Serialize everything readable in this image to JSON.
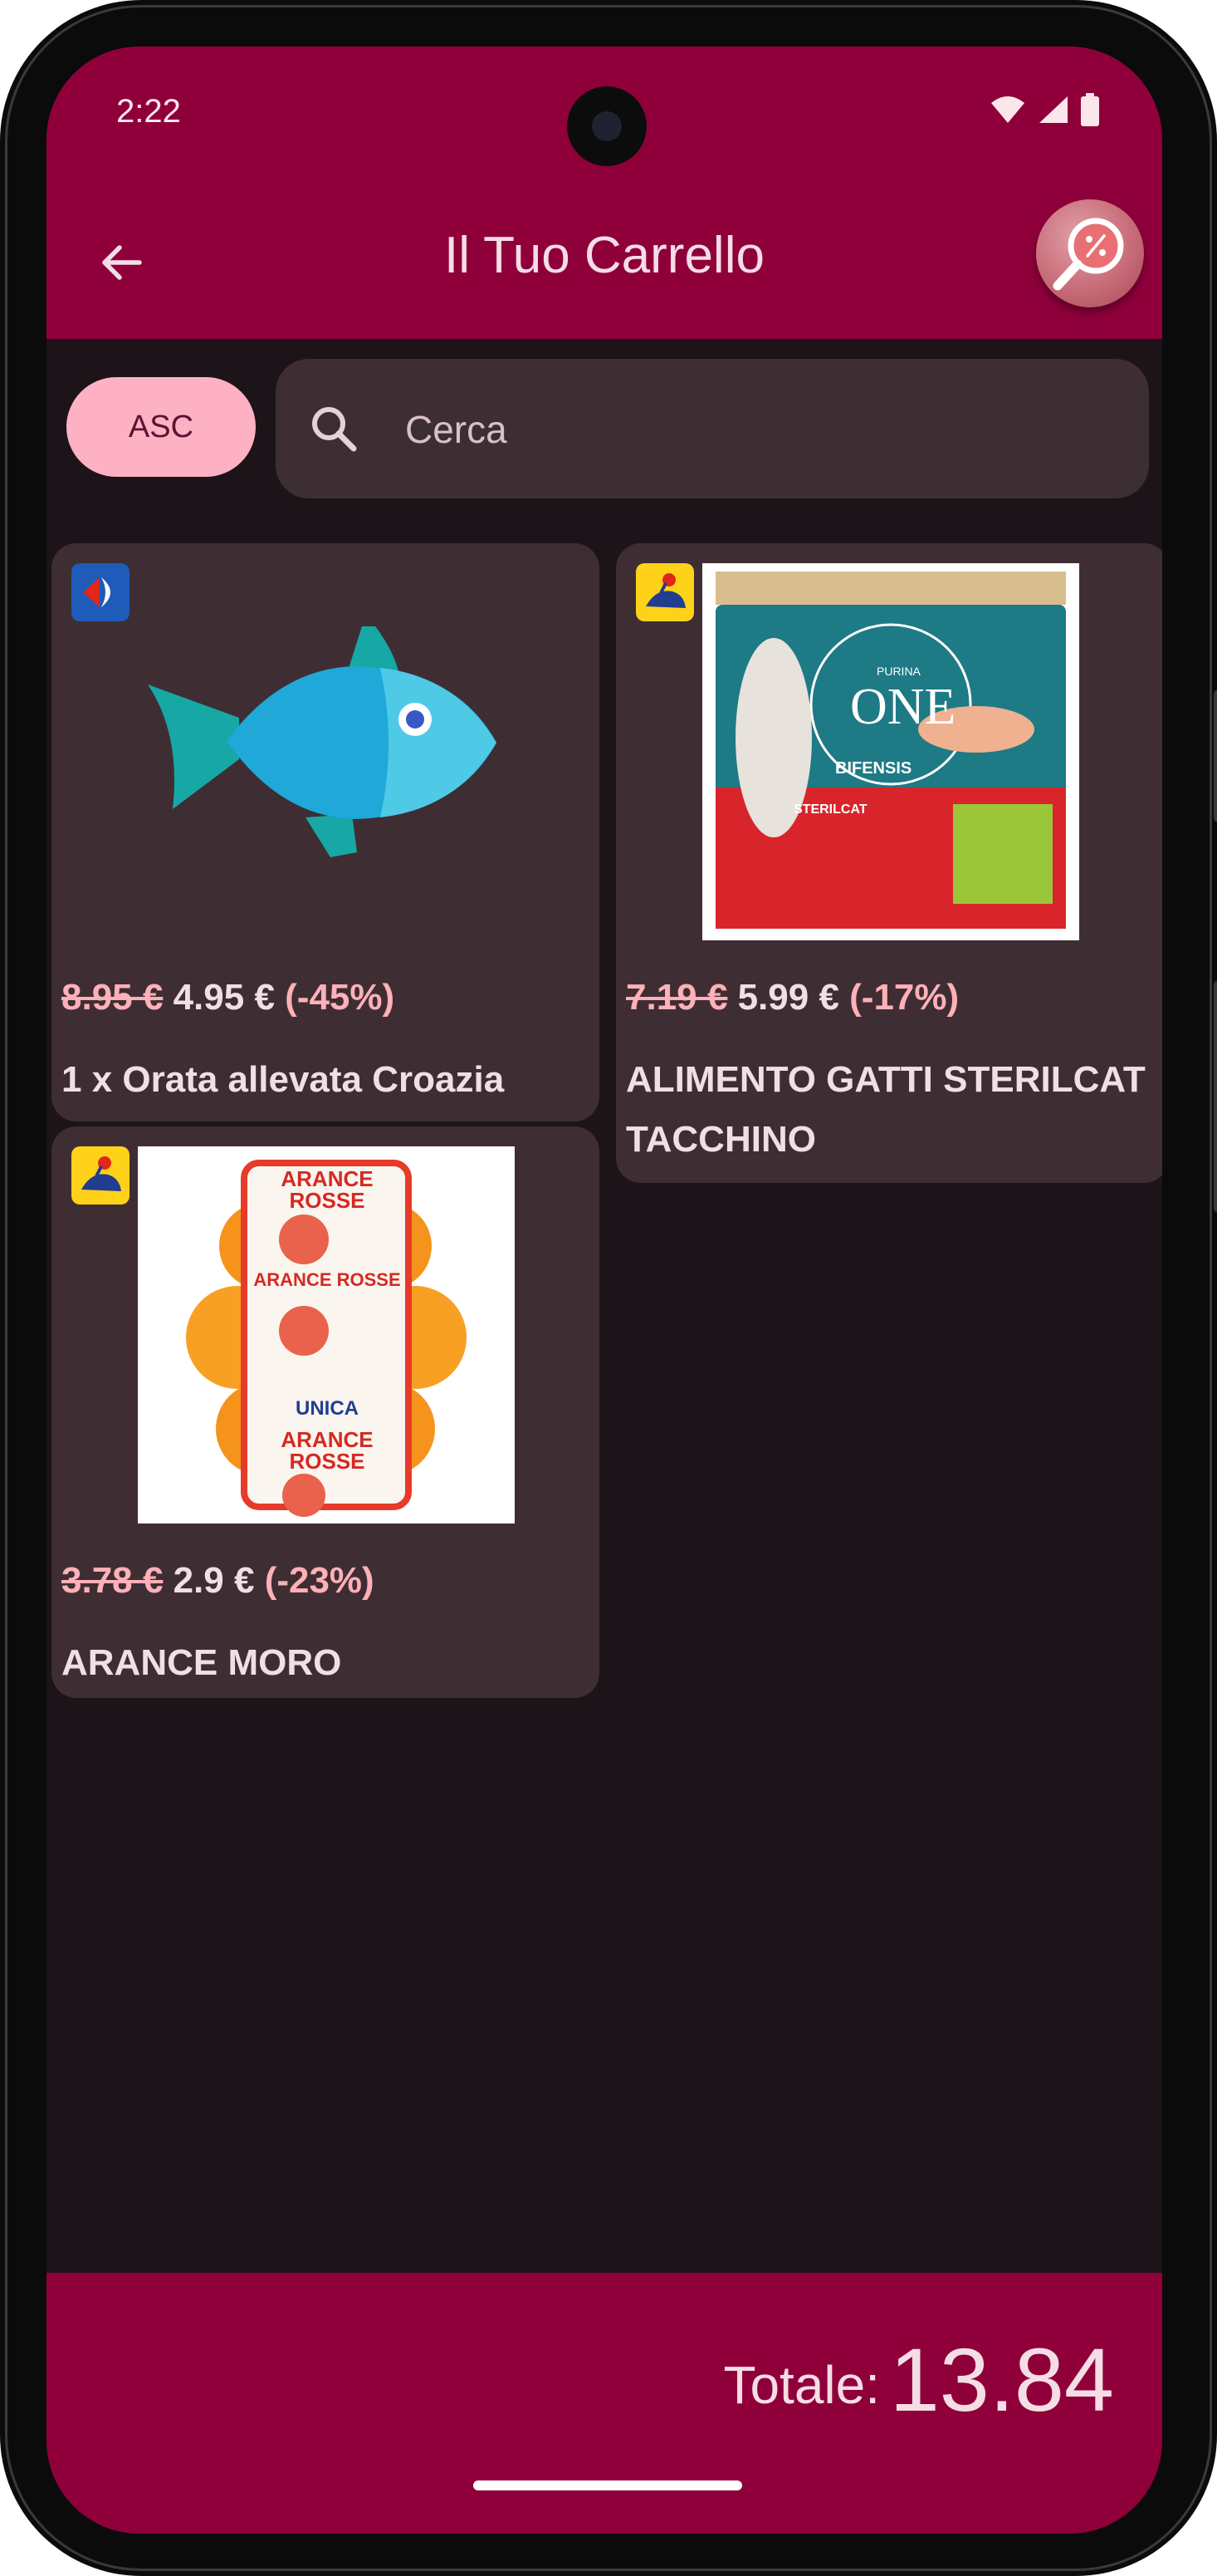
{
  "status_bar": {
    "time": "2:22"
  },
  "header": {
    "title": "Il Tuo Carrello"
  },
  "controls": {
    "sort_label": "ASC",
    "search_placeholder": "Cerca"
  },
  "products": [
    {
      "old_price": "8.95 €",
      "new_price": "4.95 €",
      "discount": "(-45%)",
      "name": "1 x Orata allevata Croazia",
      "store_icon": "carrefour-logo",
      "image": "fish-icon"
    },
    {
      "old_price": "7.19 €",
      "new_price": "5.99 €",
      "discount": "(-17%)",
      "name": "ALIMENTO GATTI STERILCAT TACCHINO",
      "store_icon": "coop-logo",
      "image": "cat-food-bag",
      "image_texts": {
        "brand": "PURINA",
        "product": "ONE",
        "line": "BIFENSIS",
        "variant": "STERILCAT"
      }
    },
    {
      "old_price": "3.78 €",
      "new_price": "2.9 €",
      "discount": "(-23%)",
      "name": "ARANCE MORO",
      "store_icon": "coop-logo",
      "image": "orange-net-bag",
      "image_texts": {
        "label": "ARANCE ROSSE",
        "brand": "UNICA"
      }
    }
  ],
  "footer": {
    "total_label": "Totale:",
    "total_value": "13.84"
  },
  "colors": {
    "primary": "#8f003b",
    "background": "#1c1418",
    "card": "#3e2e33",
    "accent_pink": "#ffb1c4",
    "discount": "#ffb0b8"
  }
}
